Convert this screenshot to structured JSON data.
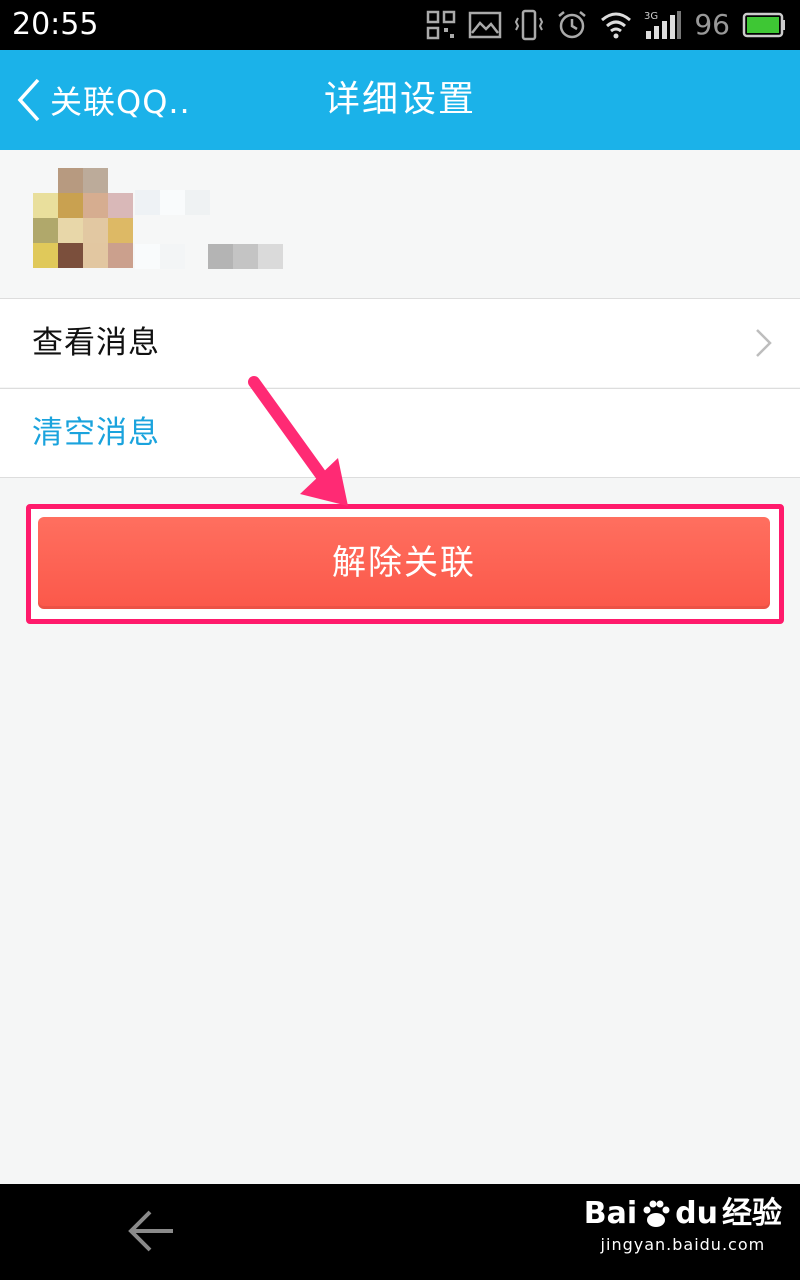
{
  "status_bar": {
    "time": "20:55",
    "network": "3G",
    "battery_level": "96",
    "icons": [
      "qr-code-icon",
      "image-icon",
      "vibrate-icon",
      "alarm-icon",
      "wifi-icon",
      "signal-icon",
      "battery-icon"
    ]
  },
  "title_bar": {
    "back_label": "关联QQ..",
    "title": "详细设置",
    "accent_color": "#1bb2e9"
  },
  "menu": {
    "view_messages": "查看消息",
    "clear_messages": "清空消息"
  },
  "unlink_button": {
    "label": "解除关联",
    "color": "#fb584a"
  },
  "annotation": {
    "highlight_color": "#ff1a6b"
  },
  "watermark": {
    "brand": "Bai",
    "brand_suffix": "du",
    "product": "经验",
    "url": "jingyan.baidu.com"
  }
}
